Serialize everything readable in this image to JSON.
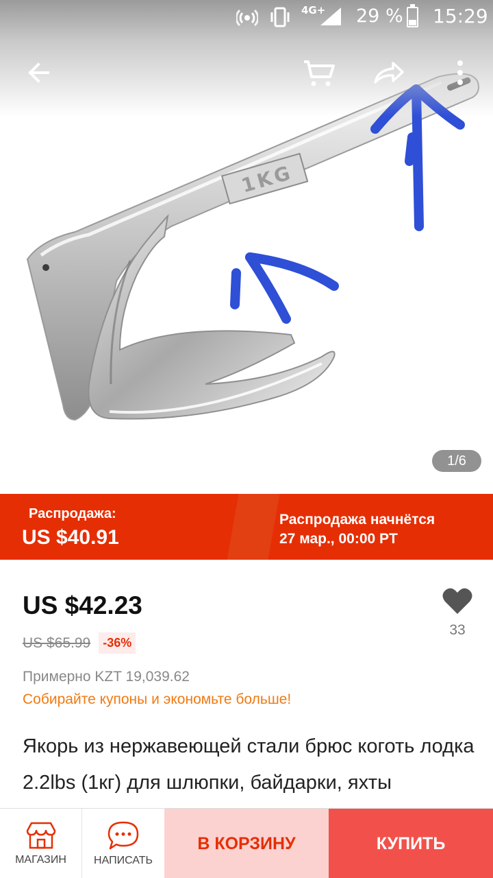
{
  "status_bar": {
    "network": "4G+",
    "battery": "29 %",
    "time": "15:29"
  },
  "gallery": {
    "stamp_text": "1KG",
    "counter": "1/6"
  },
  "sale_banner": {
    "label": "Распродажа:",
    "price": "US $40.91",
    "starts_line1": "Распродажа начнётся",
    "starts_line2": "27 мар., 00:00 PT"
  },
  "price": {
    "current": "US $42.23",
    "original": "US $65.99",
    "discount": "-36%",
    "approx": "Примерно KZT 19,039.62",
    "coupons": "Собирайте купоны и экономьте больше!"
  },
  "wishlist": {
    "count": "33"
  },
  "product": {
    "title": "Якорь из нержавеющей стали брюс коготь лодка 2.2lbs (1кг) для шлюпки, байдарки, яхты"
  },
  "bottom_bar": {
    "store_label": "МАГАЗИН",
    "message_label": "НАПИСАТЬ",
    "cart_label": "В КОРЗИНУ",
    "buy_label": "КУПИТЬ"
  },
  "colors": {
    "brand_red": "#e62e04",
    "coupon_orange": "#f07a13",
    "buy_button": "#f2514b",
    "cart_button": "#fbd2d0",
    "annotation_blue": "#2e4fd6"
  },
  "icons": [
    "back-arrow-icon",
    "cart-icon",
    "share-icon",
    "more-vert-icon",
    "heart-icon",
    "store-icon",
    "chat-icon"
  ]
}
